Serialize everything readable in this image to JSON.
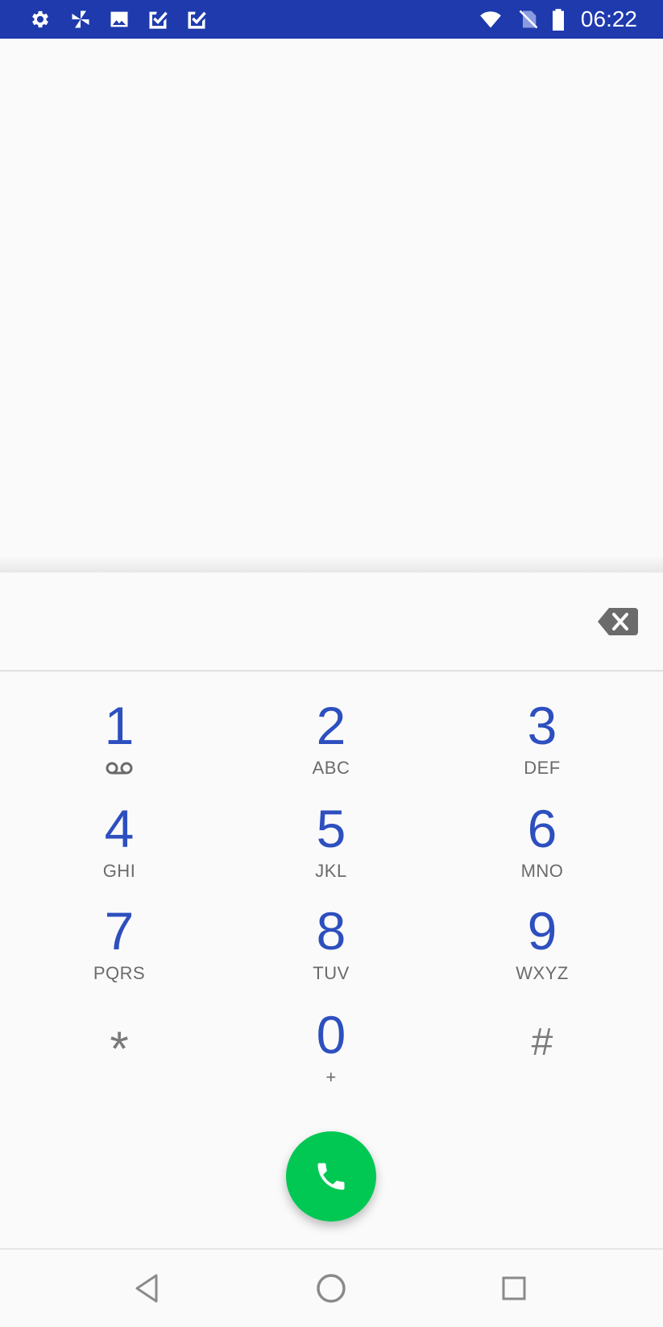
{
  "status_bar": {
    "time": "06:22",
    "background": "#1e3aad",
    "left_icons": [
      "gear-icon",
      "pinwheel-icon",
      "image-icon",
      "check-clipboard-icon",
      "check-clipboard-icon"
    ],
    "right_icons": [
      "wifi-icon",
      "no-sim-icon",
      "battery-icon"
    ]
  },
  "dialpad": {
    "digits_value": "",
    "backspace_icon": "backspace-icon",
    "keys": [
      {
        "digit": "1",
        "letters": "",
        "icon": "voicemail-icon"
      },
      {
        "digit": "2",
        "letters": "ABC"
      },
      {
        "digit": "3",
        "letters": "DEF"
      },
      {
        "digit": "4",
        "letters": "GHI"
      },
      {
        "digit": "5",
        "letters": "JKL"
      },
      {
        "digit": "6",
        "letters": "MNO"
      },
      {
        "digit": "7",
        "letters": "PQRS"
      },
      {
        "digit": "8",
        "letters": "TUV"
      },
      {
        "digit": "9",
        "letters": "WXYZ"
      },
      {
        "digit": "*",
        "letters": ""
      },
      {
        "digit": "0",
        "letters": "+"
      },
      {
        "digit": "#",
        "letters": ""
      }
    ],
    "digit_color": "#2d4fbf",
    "letters_color": "#6b6b6b"
  },
  "call_button": {
    "icon": "phone-icon",
    "color": "#00c853"
  },
  "nav_bar": {
    "buttons": [
      "back-icon",
      "home-icon",
      "recents-icon"
    ]
  }
}
